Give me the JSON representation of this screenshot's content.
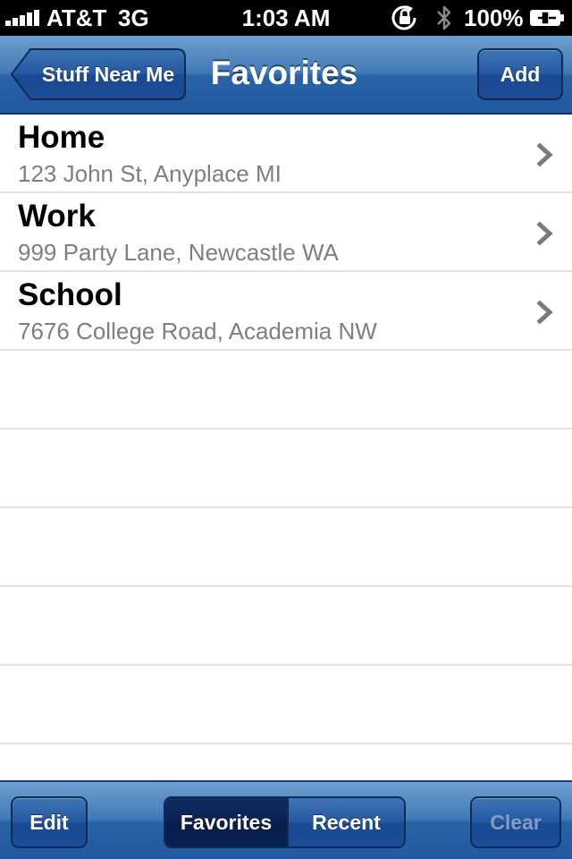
{
  "status_bar": {
    "carrier": "AT&T",
    "network": "3G",
    "time": "1:03 AM",
    "battery_percent": "100%",
    "icons": [
      "signal-bars-icon",
      "rotation-lock-icon",
      "bluetooth-icon",
      "battery-charging-icon"
    ]
  },
  "nav_bar": {
    "back_label": "Stuff Near Me",
    "title": "Favorites",
    "add_label": "Add"
  },
  "favorites": [
    {
      "name": "Home",
      "address": "123 John St, Anyplace MI"
    },
    {
      "name": "Work",
      "address": "999 Party Lane, Newcastle WA"
    },
    {
      "name": "School",
      "address": "7676 College Road, Academia NW"
    }
  ],
  "toolbar": {
    "edit_label": "Edit",
    "segments": [
      "Favorites",
      "Recent"
    ],
    "selected_segment": "Favorites",
    "clear_label": "Clear",
    "clear_enabled": false
  },
  "colors": {
    "nav_bar": "#2a63a5",
    "selected_segment": "#0a2251",
    "row_separator": "#e0e0e0",
    "subtitle_text": "#7f7f7f"
  }
}
